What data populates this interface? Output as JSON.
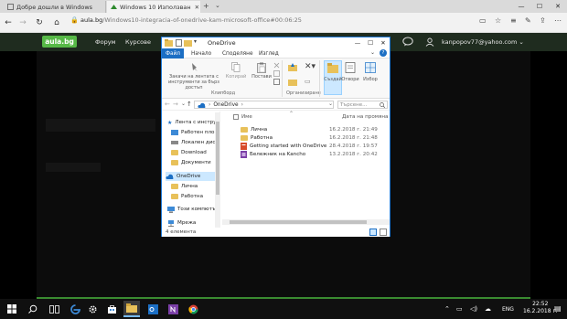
{
  "browser": {
    "tabs": [
      {
        "label": "Добре дошли в Windows"
      },
      {
        "label": "Windows 10 Използван"
      }
    ],
    "url_host": "aula.bg",
    "url_path": "/Windows10-integracia-of-onedrive-kam-microsoft-office#00:06:25"
  },
  "site": {
    "logo": "aula.bg",
    "nav": [
      "Форум",
      "Курсове"
    ],
    "user": "kanpopov77@yahoo.com"
  },
  "explorer": {
    "title": "OneDrive",
    "ribbon_tabs": [
      "Файл",
      "Начало",
      "Споделяне",
      "Изглед"
    ],
    "ribbon": {
      "pin": "Закачи на лентата с инструменти за бърз достъп",
      "copy": "Копирай",
      "paste": "Постави",
      "clipboard_group": "Клипборд",
      "organize_group": "Организиране",
      "new": "Създай",
      "open": "Отвори",
      "select": "Избор"
    },
    "address": "OneDrive",
    "search_placeholder": "Търсене...",
    "nav_items": [
      {
        "label": "Лента с инстру"
      },
      {
        "label": "Работен пло"
      },
      {
        "label": "Локален дис"
      },
      {
        "label": "Download"
      },
      {
        "label": "Документи"
      },
      {
        "label": "OneDrive"
      },
      {
        "label": "Лична"
      },
      {
        "label": "Работна"
      },
      {
        "label": "Този компютър"
      },
      {
        "label": "Мрежа"
      }
    ],
    "columns": {
      "name": "Име",
      "date": "Дата на промяна"
    },
    "files": [
      {
        "name": "Лична",
        "date": "16.2.2018 г. 21:49"
      },
      {
        "name": "Работна",
        "date": "16.2.2018 г. 21:48"
      },
      {
        "name": "Getting started with OneDrive",
        "date": "28.4.2018 г. 19:57"
      },
      {
        "name": "Бележник на Kancho",
        "date": "13.2.2018 г. 20:42"
      }
    ],
    "status": "4 елемента"
  },
  "taskbar": {
    "lang": "ENG",
    "time": "22:52",
    "date": "16.2.2018 г."
  }
}
